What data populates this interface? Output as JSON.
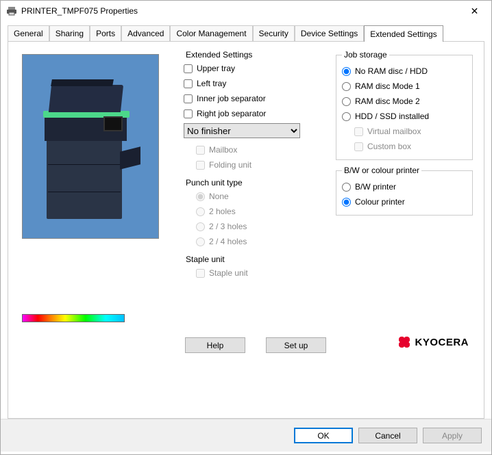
{
  "window": {
    "title": "PRINTER_TMPF075 Properties",
    "icon": "printer-icon",
    "close_label": "✕"
  },
  "tabs": [
    {
      "label": "General"
    },
    {
      "label": "Sharing"
    },
    {
      "label": "Ports"
    },
    {
      "label": "Advanced"
    },
    {
      "label": "Color Management"
    },
    {
      "label": "Security"
    },
    {
      "label": "Device Settings"
    },
    {
      "label": "Extended Settings",
      "active": true
    }
  ],
  "extended": {
    "legend": "Extended Settings",
    "upper_tray": "Upper tray",
    "left_tray": "Left tray",
    "inner_sep": "Inner job separator",
    "right_sep": "Right job separator",
    "finisher_selected": "No finisher",
    "mailbox": "Mailbox",
    "folding": "Folding unit"
  },
  "punch": {
    "legend": "Punch unit type",
    "none": "None",
    "h2": "2 holes",
    "h23": "2 / 3 holes",
    "h24": "2 / 4 holes"
  },
  "staple": {
    "legend": "Staple unit",
    "staple_unit": "Staple unit"
  },
  "job_storage": {
    "legend": "Job storage",
    "none": "No RAM disc / HDD",
    "ram1": "RAM disc Mode 1",
    "ram2": "RAM disc Mode 2",
    "hdd": "HDD / SSD installed",
    "vmail": "Virtual mailbox",
    "cbox": "Custom box"
  },
  "bw": {
    "legend": "B/W or colour printer",
    "bw": "B/W printer",
    "colour": "Colour printer"
  },
  "buttons": {
    "help": "Help",
    "setup": "Set up"
  },
  "brand": "KYOCERA",
  "footer": {
    "ok": "OK",
    "cancel": "Cancel",
    "apply": "Apply"
  }
}
